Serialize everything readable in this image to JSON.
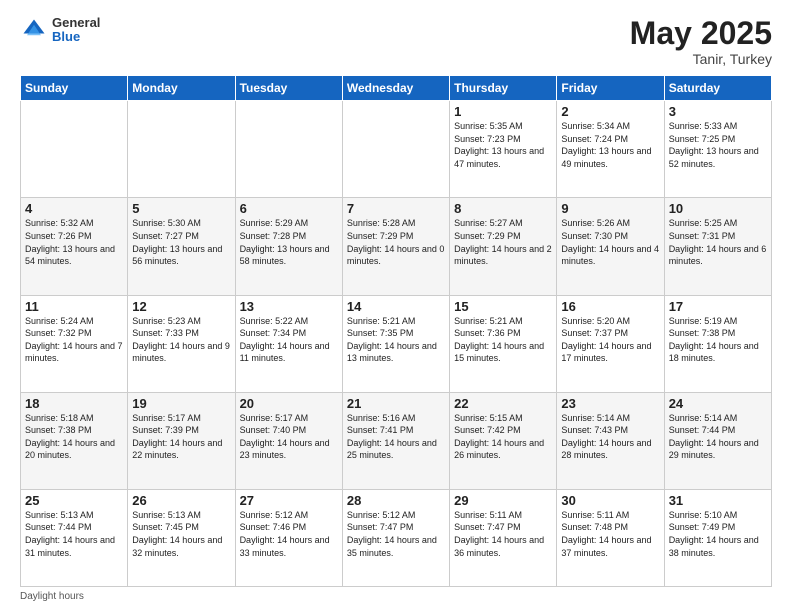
{
  "header": {
    "logo_general": "General",
    "logo_blue": "Blue",
    "month_title": "May 2025",
    "location": "Tanir, Turkey"
  },
  "days_of_week": [
    "Sunday",
    "Monday",
    "Tuesday",
    "Wednesday",
    "Thursday",
    "Friday",
    "Saturday"
  ],
  "weeks": [
    [
      {
        "day": "",
        "info": ""
      },
      {
        "day": "",
        "info": ""
      },
      {
        "day": "",
        "info": ""
      },
      {
        "day": "",
        "info": ""
      },
      {
        "day": "1",
        "info": "Sunrise: 5:35 AM\nSunset: 7:23 PM\nDaylight: 13 hours\nand 47 minutes."
      },
      {
        "day": "2",
        "info": "Sunrise: 5:34 AM\nSunset: 7:24 PM\nDaylight: 13 hours\nand 49 minutes."
      },
      {
        "day": "3",
        "info": "Sunrise: 5:33 AM\nSunset: 7:25 PM\nDaylight: 13 hours\nand 52 minutes."
      }
    ],
    [
      {
        "day": "4",
        "info": "Sunrise: 5:32 AM\nSunset: 7:26 PM\nDaylight: 13 hours\nand 54 minutes."
      },
      {
        "day": "5",
        "info": "Sunrise: 5:30 AM\nSunset: 7:27 PM\nDaylight: 13 hours\nand 56 minutes."
      },
      {
        "day": "6",
        "info": "Sunrise: 5:29 AM\nSunset: 7:28 PM\nDaylight: 13 hours\nand 58 minutes."
      },
      {
        "day": "7",
        "info": "Sunrise: 5:28 AM\nSunset: 7:29 PM\nDaylight: 14 hours\nand 0 minutes."
      },
      {
        "day": "8",
        "info": "Sunrise: 5:27 AM\nSunset: 7:29 PM\nDaylight: 14 hours\nand 2 minutes."
      },
      {
        "day": "9",
        "info": "Sunrise: 5:26 AM\nSunset: 7:30 PM\nDaylight: 14 hours\nand 4 minutes."
      },
      {
        "day": "10",
        "info": "Sunrise: 5:25 AM\nSunset: 7:31 PM\nDaylight: 14 hours\nand 6 minutes."
      }
    ],
    [
      {
        "day": "11",
        "info": "Sunrise: 5:24 AM\nSunset: 7:32 PM\nDaylight: 14 hours\nand 7 minutes."
      },
      {
        "day": "12",
        "info": "Sunrise: 5:23 AM\nSunset: 7:33 PM\nDaylight: 14 hours\nand 9 minutes."
      },
      {
        "day": "13",
        "info": "Sunrise: 5:22 AM\nSunset: 7:34 PM\nDaylight: 14 hours\nand 11 minutes."
      },
      {
        "day": "14",
        "info": "Sunrise: 5:21 AM\nSunset: 7:35 PM\nDaylight: 14 hours\nand 13 minutes."
      },
      {
        "day": "15",
        "info": "Sunrise: 5:21 AM\nSunset: 7:36 PM\nDaylight: 14 hours\nand 15 minutes."
      },
      {
        "day": "16",
        "info": "Sunrise: 5:20 AM\nSunset: 7:37 PM\nDaylight: 14 hours\nand 17 minutes."
      },
      {
        "day": "17",
        "info": "Sunrise: 5:19 AM\nSunset: 7:38 PM\nDaylight: 14 hours\nand 18 minutes."
      }
    ],
    [
      {
        "day": "18",
        "info": "Sunrise: 5:18 AM\nSunset: 7:38 PM\nDaylight: 14 hours\nand 20 minutes."
      },
      {
        "day": "19",
        "info": "Sunrise: 5:17 AM\nSunset: 7:39 PM\nDaylight: 14 hours\nand 22 minutes."
      },
      {
        "day": "20",
        "info": "Sunrise: 5:17 AM\nSunset: 7:40 PM\nDaylight: 14 hours\nand 23 minutes."
      },
      {
        "day": "21",
        "info": "Sunrise: 5:16 AM\nSunset: 7:41 PM\nDaylight: 14 hours\nand 25 minutes."
      },
      {
        "day": "22",
        "info": "Sunrise: 5:15 AM\nSunset: 7:42 PM\nDaylight: 14 hours\nand 26 minutes."
      },
      {
        "day": "23",
        "info": "Sunrise: 5:14 AM\nSunset: 7:43 PM\nDaylight: 14 hours\nand 28 minutes."
      },
      {
        "day": "24",
        "info": "Sunrise: 5:14 AM\nSunset: 7:44 PM\nDaylight: 14 hours\nand 29 minutes."
      }
    ],
    [
      {
        "day": "25",
        "info": "Sunrise: 5:13 AM\nSunset: 7:44 PM\nDaylight: 14 hours\nand 31 minutes."
      },
      {
        "day": "26",
        "info": "Sunrise: 5:13 AM\nSunset: 7:45 PM\nDaylight: 14 hours\nand 32 minutes."
      },
      {
        "day": "27",
        "info": "Sunrise: 5:12 AM\nSunset: 7:46 PM\nDaylight: 14 hours\nand 33 minutes."
      },
      {
        "day": "28",
        "info": "Sunrise: 5:12 AM\nSunset: 7:47 PM\nDaylight: 14 hours\nand 35 minutes."
      },
      {
        "day": "29",
        "info": "Sunrise: 5:11 AM\nSunset: 7:47 PM\nDaylight: 14 hours\nand 36 minutes."
      },
      {
        "day": "30",
        "info": "Sunrise: 5:11 AM\nSunset: 7:48 PM\nDaylight: 14 hours\nand 37 minutes."
      },
      {
        "day": "31",
        "info": "Sunrise: 5:10 AM\nSunset: 7:49 PM\nDaylight: 14 hours\nand 38 minutes."
      }
    ]
  ],
  "footer": {
    "daylight_hours": "Daylight hours"
  }
}
